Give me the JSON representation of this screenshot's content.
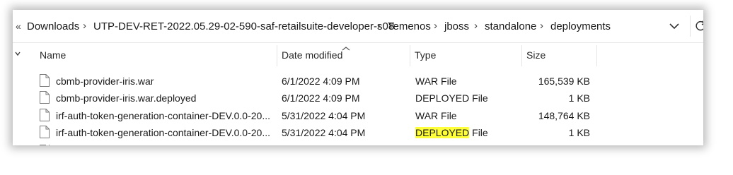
{
  "breadcrumb": {
    "truncated_indicator": "«",
    "segments": [
      "Downloads",
      "UTP-DEV-RET-2022.05.29-02-590-saf-retailsuite-developer-s08",
      "Temenos",
      "jboss",
      "standalone",
      "deployments"
    ],
    "separator": "›"
  },
  "columns": {
    "name": "Name",
    "date": "Date modified",
    "type": "Type",
    "size": "Size"
  },
  "files": [
    {
      "name": "cbmb-provider-iris.war",
      "date": "6/1/2022 4:09 PM",
      "type": "WAR File",
      "size": "165,539 KB"
    },
    {
      "name": "cbmb-provider-iris.war.deployed",
      "date": "6/1/2022 4:09 PM",
      "type": "DEPLOYED File",
      "size": "1 KB"
    },
    {
      "name": "irf-auth-token-generation-container-DEV.0.0-20...",
      "date": "5/31/2022 4:04 PM",
      "type": "WAR File",
      "size": "148,764 KB"
    },
    {
      "name": "irf-auth-token-generation-container-DEV.0.0-20...",
      "date": "5/31/2022 4:04 PM",
      "type_highlight": "DEPLOYED",
      "type_rest": " File",
      "size": "1 KB"
    }
  ],
  "colors": {
    "highlight": "#ffff3a",
    "frame_shadow": "#000000"
  },
  "icons": [
    "chevron-down-icon",
    "refresh-icon",
    "file-icon",
    "sort-arrow-icon"
  ]
}
